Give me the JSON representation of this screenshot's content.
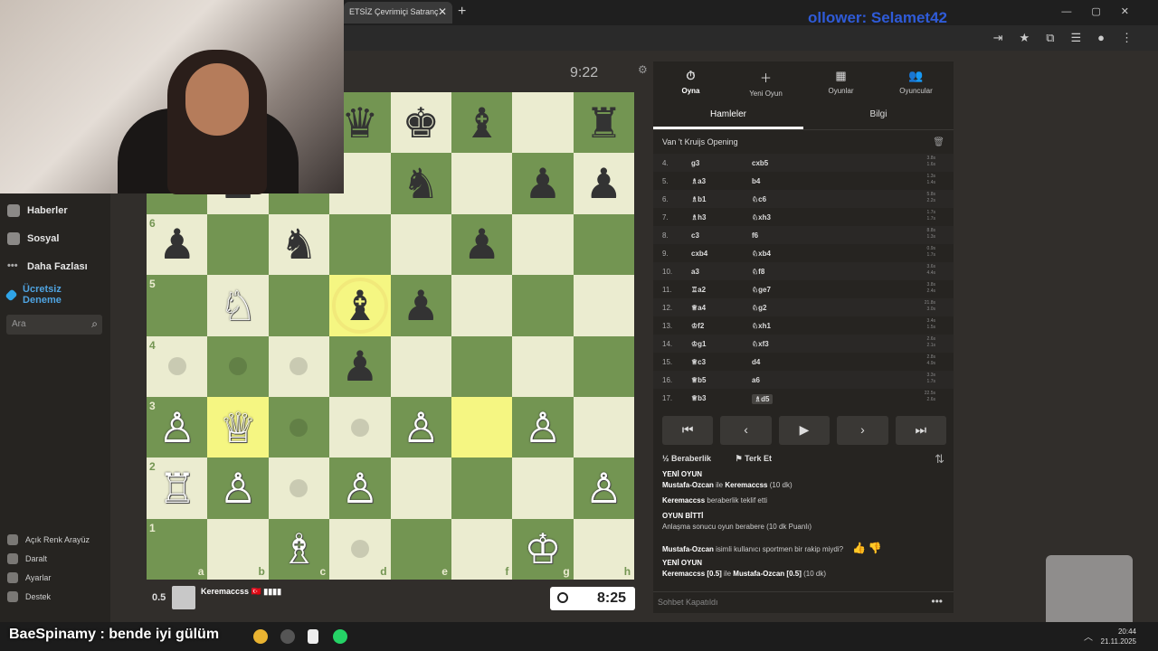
{
  "browser": {
    "tab_title": "ETSİZ Çevrimiçi Satranç",
    "tab_close": "✕",
    "new_tab": "+",
    "window_controls": "—▢✕",
    "overlay_follower": "ollower: Selamet42",
    "toolbar_icons": "⇥★⧉☰●⋮"
  },
  "sidebar": {
    "items": [
      {
        "label": "Haberler"
      },
      {
        "label": "Sosyal"
      },
      {
        "label": "Daha Fazlası"
      },
      {
        "label": "Ücretsiz Deneme"
      }
    ],
    "search_placeholder": "Ara",
    "bottom": [
      {
        "label": "Açık Renk Arayüz"
      },
      {
        "label": "Daralt"
      },
      {
        "label": "Ayarlar"
      },
      {
        "label": "Destek"
      }
    ]
  },
  "clocks": {
    "top": "9:22",
    "bottom": "8:25"
  },
  "board": {
    "ranks": [
      "6",
      "5",
      "4",
      "3",
      "2",
      "1"
    ],
    "files": [
      "a",
      "b",
      "c",
      "d",
      "e",
      "f",
      "g",
      "h"
    ],
    "squares": [
      [
        "",
        "",
        "",
        "♛",
        "♚",
        "♝",
        "",
        "♜"
      ],
      [
        "",
        "♟",
        "",
        "",
        "♞",
        "",
        "♟",
        "♟"
      ],
      [
        "♟",
        "",
        "♞",
        "",
        "",
        "♟",
        "",
        ""
      ],
      [
        "",
        "♘",
        "",
        "♝",
        "♟",
        "",
        "",
        ""
      ],
      [
        "",
        "",
        "",
        "♟",
        "",
        "",
        "",
        ""
      ],
      [
        "♙",
        "♕",
        "",
        "",
        "♙",
        "",
        "♙",
        ""
      ],
      [
        "♖",
        "♙",
        "",
        "♙",
        "",
        "",
        "",
        "♙"
      ],
      [
        "",
        "",
        "♗",
        "",
        "",
        "",
        "♔",
        ""
      ]
    ],
    "colors": [
      [
        "w",
        "w",
        "w",
        "b",
        "b",
        "b",
        "w",
        "b"
      ],
      [
        "w",
        "b",
        "w",
        "w",
        "b",
        "w",
        "b",
        "b"
      ],
      [
        "b",
        "w",
        "b",
        "w",
        "w",
        "b",
        "w",
        "w"
      ],
      [
        "w",
        "w",
        "w",
        "b",
        "b",
        "w",
        "w",
        "w"
      ],
      [
        "w",
        "w",
        "w",
        "b",
        "w",
        "w",
        "w",
        "w"
      ],
      [
        "w",
        "w",
        "w",
        "w",
        "w",
        "w",
        "w",
        "w"
      ],
      [
        "w",
        "w",
        "w",
        "w",
        "w",
        "w",
        "w",
        "w"
      ],
      [
        "w",
        "w",
        "w",
        "w",
        "w",
        "w",
        "w",
        "w"
      ]
    ]
  },
  "player": {
    "score": "0.5",
    "name": "Keremaccss 🇹🇷 ▮▮▮▮"
  },
  "panel": {
    "nav": [
      {
        "icon": "⏱",
        "label": "Oyna"
      },
      {
        "icon": "＋",
        "label": "Yeni Oyun"
      },
      {
        "icon": "▦",
        "label": "Oyunlar"
      },
      {
        "icon": "👥",
        "label": "Oyuncular"
      }
    ],
    "subtabs": [
      "Hamleler",
      "Bilgi"
    ],
    "opening": "Van 't Kruijs Opening",
    "moves": [
      {
        "n": "4.",
        "w": "g3",
        "b": "cxb5",
        "t1": "3.8s",
        "t2": "1.6s"
      },
      {
        "n": "5.",
        "w": "♗a3",
        "b": "b4",
        "t1": "1.3s",
        "t2": "1.4s"
      },
      {
        "n": "6.",
        "w": "♗b1",
        "b": "♘c6",
        "t1": "5.8s",
        "t2": "2.2s"
      },
      {
        "n": "7.",
        "w": "♗h3",
        "b": "♘xh3",
        "t1": "1.7s",
        "t2": "1.7s"
      },
      {
        "n": "8.",
        "w": "c3",
        "b": "f6",
        "t1": "8.8s",
        "t2": "1.3s"
      },
      {
        "n": "9.",
        "w": "cxb4",
        "b": "♘xb4",
        "t1": "0.9s",
        "t2": "1.7s"
      },
      {
        "n": "10.",
        "w": "a3",
        "b": "♘f8",
        "t1": "3.6s",
        "t2": "4.4s"
      },
      {
        "n": "11.",
        "w": "♖a2",
        "b": "♘ge7",
        "t1": "3.8s",
        "t2": "2.4s"
      },
      {
        "n": "12.",
        "w": "♕a4",
        "b": "♘g2",
        "t1": "21.8s",
        "t2": "3.0s"
      },
      {
        "n": "13.",
        "w": "♔f2",
        "b": "♘xh1",
        "t1": "3.4s",
        "t2": "1.5s"
      },
      {
        "n": "14.",
        "w": "♔g1",
        "b": "♘xf3",
        "t1": "2.6s",
        "t2": "2.1s"
      },
      {
        "n": "15.",
        "w": "♕c3",
        "b": "d4",
        "t1": "2.8s",
        "t2": "4.9s"
      },
      {
        "n": "16.",
        "w": "♕b5",
        "b": "a6",
        "t1": "3.3s",
        "t2": "1.7s"
      },
      {
        "n": "17.",
        "w": "♕b3",
        "b": "♗d5",
        "t1": "22.5s",
        "t2": "2.6s"
      }
    ],
    "controls": [
      "⏮",
      "‹",
      "▶",
      "›",
      "⏭"
    ],
    "draw_label": "Beraberlik",
    "resign_label": "Terk Et",
    "chat": {
      "l1_title": "YENİ OYUN",
      "l1_text_a": "Mustafa-Ozcan",
      "l1_text_b": " ile ",
      "l1_text_c": "Keremaccss",
      "l1_text_d": " (10 dk)",
      "l2_name": "Keremaccss",
      "l2_text": " beraberlik teklif etti",
      "l3_title": "OYUN BİTTİ",
      "l3_text": "Anlaşma sonucu oyun berabere (10 dk Puanlı)",
      "l4_name": "Mustafa-Ozcan",
      "l4_text": " isimli kullanıcı sportmen bir rakip miydi?",
      "l5_title": "YENİ OYUN",
      "l5_text_a": "Keremaccss [0.5]",
      "l5_text_b": " ile ",
      "l5_text_c": "Mustafa-Ozcan [0.5]",
      "l5_text_d": " (10 dk)"
    },
    "chat_closed": "Sohbet Kapatıldı"
  },
  "taskbar": {
    "overlay": "BaeSpinamy : bende iyi gülüm",
    "time": "20:44",
    "date": "21.11.2025"
  }
}
